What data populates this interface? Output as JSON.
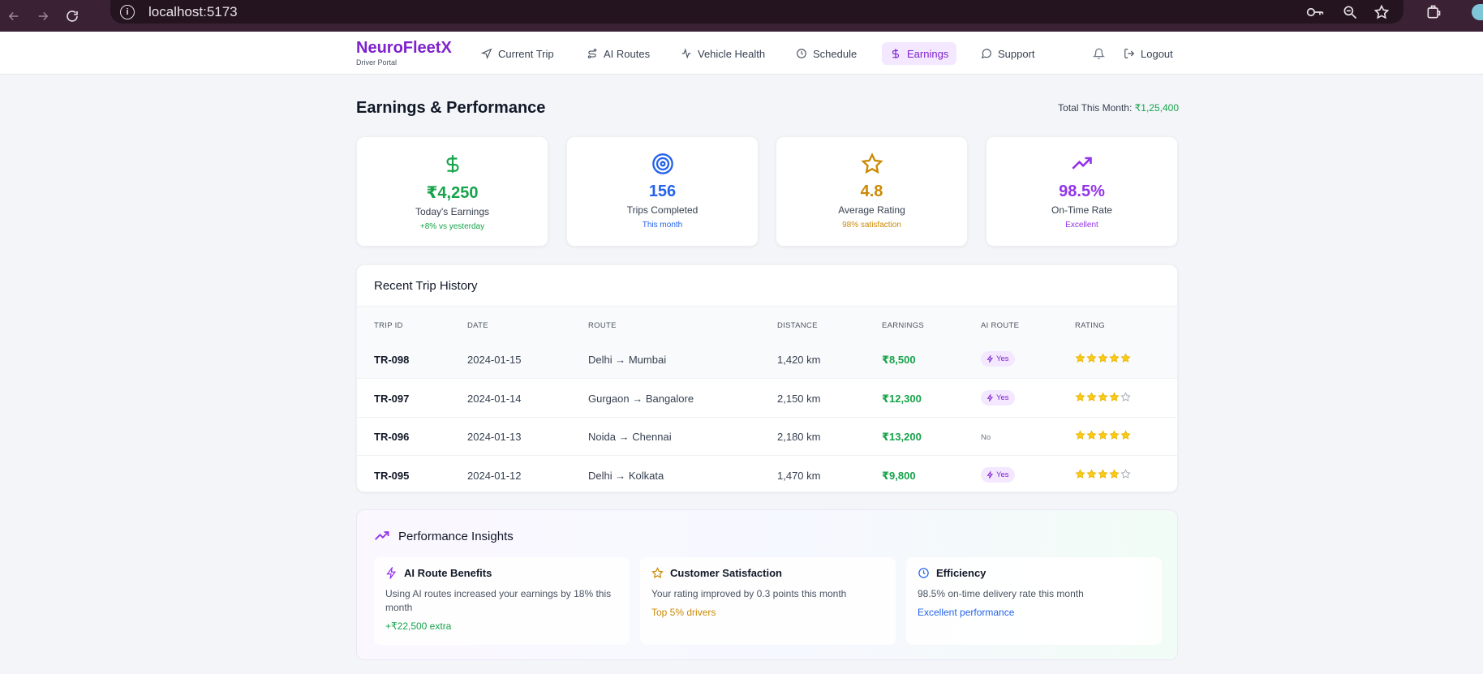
{
  "browser": {
    "url": "localhost:5173"
  },
  "header": {
    "brand": "NeuroFleetX",
    "subtitle": "Driver Portal",
    "nav": [
      {
        "label": "Current Trip",
        "icon": "navigation-icon"
      },
      {
        "label": "AI Routes",
        "icon": "route-icon"
      },
      {
        "label": "Vehicle Health",
        "icon": "activity-icon"
      },
      {
        "label": "Schedule",
        "icon": "clock-icon"
      },
      {
        "label": "Earnings",
        "icon": "dollar-icon",
        "active": true
      },
      {
        "label": "Support",
        "icon": "chat-icon"
      }
    ],
    "logout_label": "Logout"
  },
  "page": {
    "title": "Earnings & Performance",
    "total_label": "Total This Month: ",
    "total_value": "₹1,25,400"
  },
  "stats": [
    {
      "value": "₹4,250",
      "label": "Today's Earnings",
      "sub": "+8% vs yesterday",
      "color": "#16a34a",
      "icon": "dollar-icon"
    },
    {
      "value": "156",
      "label": "Trips Completed",
      "sub": "This month",
      "color": "#2563eb",
      "icon": "target-icon"
    },
    {
      "value": "4.8",
      "label": "Average Rating",
      "sub": "98% satisfaction",
      "color": "#ca8a04",
      "icon": "star-icon"
    },
    {
      "value": "98.5%",
      "label": "On-Time Rate",
      "sub": "Excellent",
      "color": "#9333ea",
      "icon": "trending-up-icon"
    }
  ],
  "trips": {
    "title": "Recent Trip History",
    "columns": [
      "TRIP ID",
      "DATE",
      "ROUTE",
      "DISTANCE",
      "EARNINGS",
      "AI ROUTE",
      "RATING"
    ],
    "rows": [
      {
        "id": "TR-098",
        "date": "2024-01-15",
        "route": "Delhi → Mumbai",
        "distance": "1,420 km",
        "earnings": "₹8,500",
        "ai": "Yes",
        "rating": 5
      },
      {
        "id": "TR-097",
        "date": "2024-01-14",
        "route": "Gurgaon → Bangalore",
        "distance": "2,150 km",
        "earnings": "₹12,300",
        "ai": "Yes",
        "rating": 4
      },
      {
        "id": "TR-096",
        "date": "2024-01-13",
        "route": "Noida → Chennai",
        "distance": "2,180 km",
        "earnings": "₹13,200",
        "ai": "No",
        "rating": 5
      },
      {
        "id": "TR-095",
        "date": "2024-01-12",
        "route": "Delhi → Kolkata",
        "distance": "1,470 km",
        "earnings": "₹9,800",
        "ai": "Yes",
        "rating": 4
      }
    ]
  },
  "insights": {
    "title": "Performance Insights",
    "cards": [
      {
        "title": "AI Route Benefits",
        "desc": "Using AI routes increased your earnings by 18% this month",
        "foot": "+₹22,500 extra",
        "color": "#16a34a",
        "icon": "zap-icon"
      },
      {
        "title": "Customer Satisfaction",
        "desc": "Your rating improved by 0.3 points this month",
        "foot": "Top 5% drivers",
        "color": "#ca8a04",
        "icon": "star-icon"
      },
      {
        "title": "Efficiency",
        "desc": "98.5% on-time delivery rate this month",
        "foot": "Excellent performance",
        "color": "#2563eb",
        "icon": "clock-icon"
      }
    ]
  }
}
